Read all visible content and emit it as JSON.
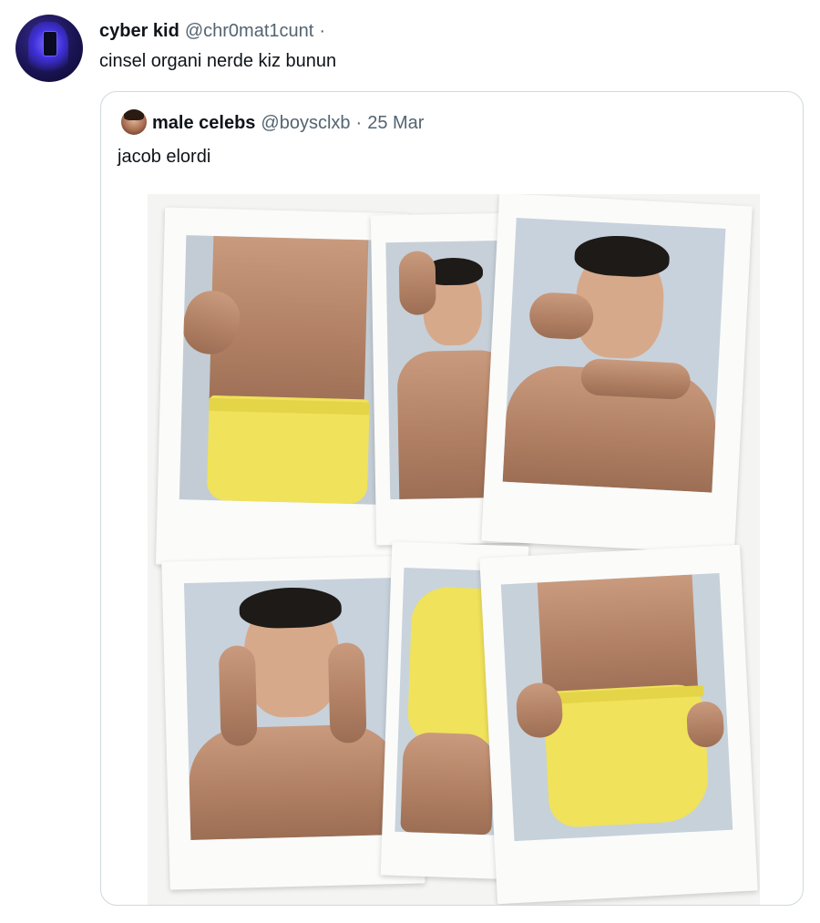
{
  "tweet": {
    "author": {
      "display_name": "cyber kid",
      "handle": "@chr0mat1cunt",
      "separator": "·"
    },
    "text": "cinsel organi nerde kiz bunun"
  },
  "quoted_tweet": {
    "author": {
      "display_name": "male celebs",
      "handle": "@boysclxb",
      "separator": "·",
      "date": "25 Mar"
    },
    "text": "jacob elordi"
  },
  "colors": {
    "text_primary": "#0f1419",
    "text_secondary": "#536471",
    "border": "#cfd9de",
    "underwear": "#f0e25a"
  },
  "icons": {
    "author_avatar": "user-avatar-icon",
    "quoted_avatar": "user-avatar-icon"
  }
}
